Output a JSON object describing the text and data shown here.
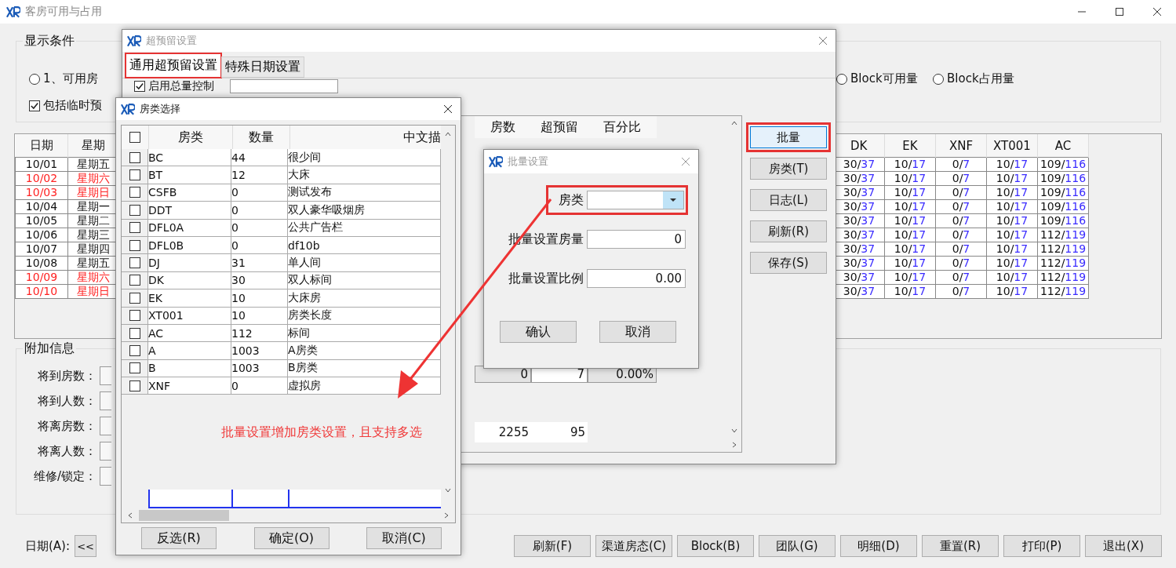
{
  "main_window": {
    "title": "客房可用与占用",
    "display_group": {
      "title": "显示条件",
      "options": [
        {
          "kind": "radio",
          "label": "1、可用房",
          "checked": false
        },
        {
          "kind": "checkbox",
          "label": "包括临时预",
          "checked": true
        },
        {
          "kind": "radio",
          "label": "Block可用量",
          "checked": false
        },
        {
          "kind": "radio",
          "label": "Block占用量",
          "checked": false
        }
      ]
    },
    "date_table": {
      "columns": [
        "日期",
        "星期"
      ],
      "rows": [
        {
          "date": "10/01",
          "weekday": "星期五",
          "weekend": false
        },
        {
          "date": "10/02",
          "weekday": "星期六",
          "weekend": true
        },
        {
          "date": "10/03",
          "weekday": "星期日",
          "weekend": true
        },
        {
          "date": "10/04",
          "weekday": "星期一",
          "weekend": false
        },
        {
          "date": "10/05",
          "weekday": "星期二",
          "weekend": false
        },
        {
          "date": "10/06",
          "weekday": "星期三",
          "weekend": false
        },
        {
          "date": "10/07",
          "weekday": "星期四",
          "weekend": false
        },
        {
          "date": "10/08",
          "weekday": "星期五",
          "weekend": false
        },
        {
          "date": "10/09",
          "weekday": "星期六",
          "weekend": true
        },
        {
          "date": "10/10",
          "weekday": "星期日",
          "weekend": true
        }
      ]
    },
    "room_table": {
      "columns": [
        "DK",
        "EK",
        "XNF",
        "XT001",
        "AC"
      ],
      "rows": [
        [
          {
            "used": "30/",
            "total": "37"
          },
          {
            "used": "10/",
            "total": "17"
          },
          {
            "used": "0/",
            "total": "7"
          },
          {
            "used": "10/",
            "total": "17"
          },
          {
            "used": "109/",
            "total": "116"
          }
        ],
        [
          {
            "used": "30/",
            "total": "37"
          },
          {
            "used": "10/",
            "total": "17"
          },
          {
            "used": "0/",
            "total": "7"
          },
          {
            "used": "10/",
            "total": "17"
          },
          {
            "used": "109/",
            "total": "116"
          }
        ],
        [
          {
            "used": "30/",
            "total": "37"
          },
          {
            "used": "10/",
            "total": "17"
          },
          {
            "used": "0/",
            "total": "7"
          },
          {
            "used": "10/",
            "total": "17"
          },
          {
            "used": "109/",
            "total": "116"
          }
        ],
        [
          {
            "used": "30/",
            "total": "37"
          },
          {
            "used": "10/",
            "total": "17"
          },
          {
            "used": "0/",
            "total": "7"
          },
          {
            "used": "10/",
            "total": "17"
          },
          {
            "used": "109/",
            "total": "116"
          }
        ],
        [
          {
            "used": "30/",
            "total": "37"
          },
          {
            "used": "10/",
            "total": "17"
          },
          {
            "used": "0/",
            "total": "7"
          },
          {
            "used": "10/",
            "total": "17"
          },
          {
            "used": "109/",
            "total": "116"
          }
        ],
        [
          {
            "used": "30/",
            "total": "37"
          },
          {
            "used": "10/",
            "total": "17"
          },
          {
            "used": "0/",
            "total": "7"
          },
          {
            "used": "10/",
            "total": "17"
          },
          {
            "used": "112/",
            "total": "119"
          }
        ],
        [
          {
            "used": "30/",
            "total": "37"
          },
          {
            "used": "10/",
            "total": "17"
          },
          {
            "used": "0/",
            "total": "7"
          },
          {
            "used": "10/",
            "total": "17"
          },
          {
            "used": "112/",
            "total": "119"
          }
        ],
        [
          {
            "used": "30/",
            "total": "37"
          },
          {
            "used": "10/",
            "total": "17"
          },
          {
            "used": "0/",
            "total": "7"
          },
          {
            "used": "10/",
            "total": "17"
          },
          {
            "used": "112/",
            "total": "119"
          }
        ],
        [
          {
            "used": "30/",
            "total": "37"
          },
          {
            "used": "10/",
            "total": "17"
          },
          {
            "used": "0/",
            "total": "7"
          },
          {
            "used": "10/",
            "total": "17"
          },
          {
            "used": "112/",
            "total": "119"
          }
        ],
        [
          {
            "used": "30/",
            "total": "37"
          },
          {
            "used": "10/",
            "total": "17"
          },
          {
            "used": "0/",
            "total": "7"
          },
          {
            "used": "10/",
            "total": "17"
          },
          {
            "used": "112/",
            "total": "119"
          }
        ]
      ]
    },
    "extra_group": {
      "title": "附加信息",
      "labels": [
        "将到房数：",
        "将到人数：",
        "将离房数：",
        "将离人数：",
        "维修/锁定："
      ]
    },
    "date_label": "日期(A):",
    "prev_button": "<<",
    "buttons": [
      "刷新(F)",
      "渠道房态(C)",
      "Block(B)",
      "团队(G)",
      "明细(D)",
      "重置(R)",
      "打印(P)",
      "退出(X)"
    ]
  },
  "overbook_dialog": {
    "title": "超预留设置",
    "tabs": [
      {
        "label": "通用超预留设置",
        "selected": true,
        "highlighted": true
      },
      {
        "label": "特殊日期设置",
        "selected": false,
        "highlighted": false
      }
    ],
    "total_control": {
      "label": "启用总量控制",
      "checked": true
    },
    "columns": [
      "房数",
      "超预留",
      "百分比"
    ],
    "rows": [
      {
        "rooms": "0",
        "overbook": "7",
        "percent": "0.00%"
      }
    ],
    "totals": {
      "rooms": "2255",
      "overbook": "95"
    },
    "buttons": [
      {
        "label": "批量",
        "highlighted": true
      },
      {
        "label": "房类(T)",
        "highlighted": false
      },
      {
        "label": "日志(L)",
        "highlighted": false
      },
      {
        "label": "刷新(R)",
        "highlighted": false
      },
      {
        "label": "保存(S)",
        "highlighted": false
      }
    ]
  },
  "room_type_dialog": {
    "title": "房类选择",
    "all_checked": false,
    "columns": [
      "房类",
      "数量",
      "中文描"
    ],
    "rows": [
      {
        "code": "BC",
        "count": "44",
        "desc": "很少间",
        "checked": false
      },
      {
        "code": "BT",
        "count": "12",
        "desc": "大床",
        "checked": false
      },
      {
        "code": "CSFB",
        "count": "0",
        "desc": "测试发布",
        "checked": false
      },
      {
        "code": "DDT",
        "count": "0",
        "desc": "双人豪华吸烟房",
        "checked": false
      },
      {
        "code": "DFL0A",
        "count": "0",
        "desc": "公共广告栏",
        "checked": false
      },
      {
        "code": "DFL0B",
        "count": "0",
        "desc": "df10b",
        "checked": false
      },
      {
        "code": "DJ",
        "count": "31",
        "desc": "单人间",
        "checked": false
      },
      {
        "code": "DK",
        "count": "30",
        "desc": "双人标间",
        "checked": false
      },
      {
        "code": "EK",
        "count": "10",
        "desc": "大床房",
        "checked": false
      },
      {
        "code": "XT001",
        "count": "10",
        "desc": "房类长度",
        "checked": false
      },
      {
        "code": "AC",
        "count": "112",
        "desc": "标间",
        "checked": false
      },
      {
        "code": "A",
        "count": "1003",
        "desc": "A房类",
        "checked": false
      },
      {
        "code": "B",
        "count": "1003",
        "desc": "B房类",
        "checked": false
      },
      {
        "code": "XNF",
        "count": "0",
        "desc": "虚拟房",
        "checked": false
      }
    ],
    "annotation": "批量设置增加房类设置，且支持多选",
    "buttons": [
      "反选(R)",
      "确定(O)",
      "取消(C)"
    ]
  },
  "batch_dialog": {
    "title": "批量设置",
    "fields": [
      {
        "kind": "select",
        "label": "房类",
        "highlighted": true
      },
      {
        "kind": "number",
        "label": "批量设置房量",
        "value": "0",
        "highlighted": false
      },
      {
        "kind": "number",
        "label": "批量设置比例",
        "value": "0.00",
        "highlighted": false
      }
    ],
    "buttons": [
      "确认",
      "取消"
    ]
  }
}
